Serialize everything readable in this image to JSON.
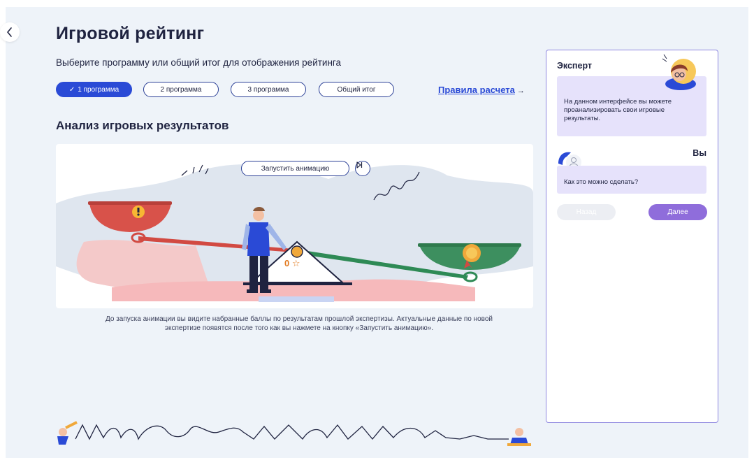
{
  "header": {
    "title": "Игровой рейтинг",
    "subtitle": "Выберите программу или общий итог для отображения рейтинга"
  },
  "tabs": [
    {
      "label": "1 программа",
      "active": true
    },
    {
      "label": "2 программа",
      "active": false
    },
    {
      "label": "3 программа",
      "active": false
    },
    {
      "label": "Общий итог",
      "active": false
    }
  ],
  "rules_link": {
    "label": "Правила расчета",
    "arrow": "→"
  },
  "section": {
    "title": "Анализ игровых результатов"
  },
  "animation": {
    "start_button": "Запустить анимацию",
    "score": "0",
    "skip_icon": "skip-forward-icon",
    "description": "До запуска анимации вы видите набранные баллы по результатам прошлой экспертизы. Актуальные данные по новой экспертизе появятся после того как вы нажмете на кнопку «Запустить анимацию»."
  },
  "chat": {
    "expert": {
      "name": "Эксперт",
      "message": "На данном интерфейсе вы можете проанализировать свои игровые результаты."
    },
    "user": {
      "name": "Вы",
      "message": "Как это можно сделать?"
    },
    "back_button": "Назад",
    "next_button": "Далее"
  },
  "colors": {
    "accent": "#2a4ad6",
    "bubble": "#e6e2fb",
    "next_button": "#8f6ddb",
    "chat_border": "#8e87e0"
  }
}
